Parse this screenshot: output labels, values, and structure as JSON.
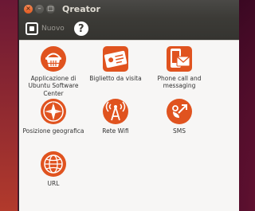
{
  "window": {
    "title": "Qreator",
    "buttons": {
      "close": "×",
      "minimize": "–",
      "maximize": "□"
    }
  },
  "toolbar": {
    "new_label": "Nuovo",
    "new_icon": "new-document-icon",
    "help_icon": "help-icon",
    "help_glyph": "?"
  },
  "colors": {
    "accent": "#e0531f",
    "titlebar": "#3c3b37",
    "background": "#f7f6f5"
  },
  "items": [
    {
      "label": "Applicazione di Ubuntu Software Center",
      "icon": "software-center-icon"
    },
    {
      "label": "Biglietto da visita",
      "icon": "business-card-icon"
    },
    {
      "label": "Phone call and messaging",
      "icon": "phone-message-icon"
    },
    {
      "label": "Posizione geografica",
      "icon": "compass-icon"
    },
    {
      "label": "Rete Wifi",
      "icon": "wifi-tower-icon"
    },
    {
      "label": "SMS",
      "icon": "sms-icon"
    },
    {
      "label": "URL",
      "icon": "globe-icon"
    }
  ]
}
